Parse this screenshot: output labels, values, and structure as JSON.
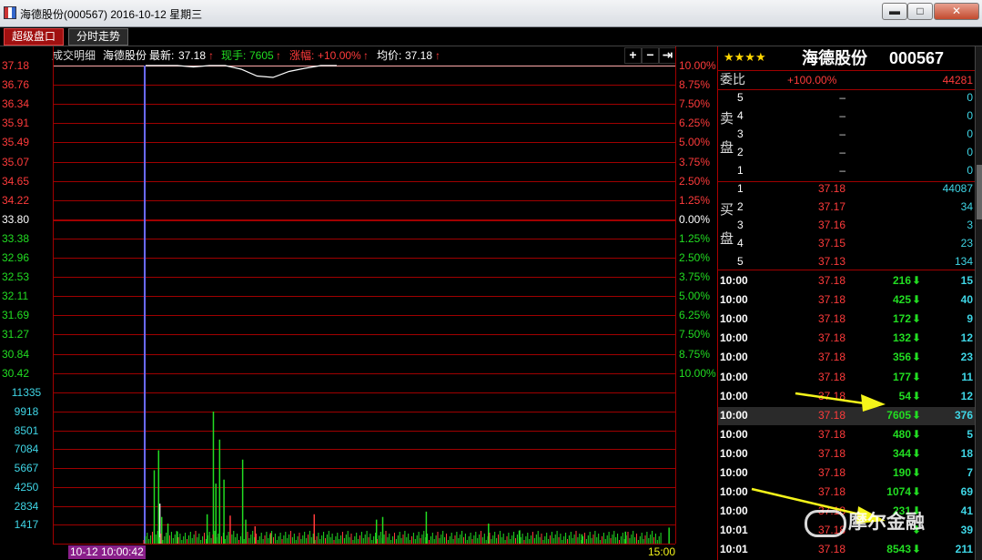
{
  "window": {
    "title": "海德股份(000567) 2016-10-12 星期三",
    "min": "▬",
    "max": "□",
    "close": "✕"
  },
  "tabs": [
    {
      "label": "超级盘口",
      "active": true
    },
    {
      "label": "分时走势",
      "active": false
    }
  ],
  "chart_header": {
    "label_detail": "成交明细",
    "stock": "海德股份",
    "latest_label": "最新:",
    "latest_value": "37.18",
    "volume_label": "现手:",
    "volume_value": "7605",
    "change_label": "涨幅:",
    "change_value": "+10.00%",
    "avg_label": "均价:",
    "avg_value": "37.18",
    "tools": [
      "+",
      "−",
      "⇥"
    ]
  },
  "price_axis": {
    "left": [
      {
        "v": "37.18",
        "c": "#ff3b3b"
      },
      {
        "v": "36.76",
        "c": "#ff3b3b"
      },
      {
        "v": "36.34",
        "c": "#ff3b3b"
      },
      {
        "v": "35.91",
        "c": "#ff3b3b"
      },
      {
        "v": "35.49",
        "c": "#ff3b3b"
      },
      {
        "v": "35.07",
        "c": "#ff3b3b"
      },
      {
        "v": "34.65",
        "c": "#ff3b3b"
      },
      {
        "v": "34.22",
        "c": "#ff3b3b"
      },
      {
        "v": "33.80",
        "c": "#ffffff"
      },
      {
        "v": "33.38",
        "c": "#22dd22"
      },
      {
        "v": "32.96",
        "c": "#22dd22"
      },
      {
        "v": "32.53",
        "c": "#22dd22"
      },
      {
        "v": "32.11",
        "c": "#22dd22"
      },
      {
        "v": "31.69",
        "c": "#22dd22"
      },
      {
        "v": "31.27",
        "c": "#22dd22"
      },
      {
        "v": "30.84",
        "c": "#22dd22"
      },
      {
        "v": "30.42",
        "c": "#22dd22"
      }
    ],
    "right": [
      {
        "v": "10.00%",
        "c": "#ff3b3b"
      },
      {
        "v": "8.75%",
        "c": "#ff3b3b"
      },
      {
        "v": "7.50%",
        "c": "#ff3b3b"
      },
      {
        "v": "6.25%",
        "c": "#ff3b3b"
      },
      {
        "v": "5.00%",
        "c": "#ff3b3b"
      },
      {
        "v": "3.75%",
        "c": "#ff3b3b"
      },
      {
        "v": "2.50%",
        "c": "#ff3b3b"
      },
      {
        "v": "1.25%",
        "c": "#ff3b3b"
      },
      {
        "v": "0.00%",
        "c": "#ffffff"
      },
      {
        "v": "1.25%",
        "c": "#22dd22"
      },
      {
        "v": "2.50%",
        "c": "#22dd22"
      },
      {
        "v": "3.75%",
        "c": "#22dd22"
      },
      {
        "v": "5.00%",
        "c": "#22dd22"
      },
      {
        "v": "6.25%",
        "c": "#22dd22"
      },
      {
        "v": "7.50%",
        "c": "#22dd22"
      },
      {
        "v": "8.75%",
        "c": "#22dd22"
      },
      {
        "v": "10.00%",
        "c": "#22dd22"
      }
    ]
  },
  "volume_axis": [
    "11335",
    "9918",
    "8501",
    "7084",
    "5667",
    "4250",
    "2834",
    "1417"
  ],
  "time_axis": {
    "cursor": "10-12 10:00:42",
    "end": "15:00"
  },
  "chart_data": {
    "type": "line",
    "price_range": [
      30.42,
      37.18
    ],
    "volume_range": [
      0,
      11335
    ],
    "price_series": {
      "values": [
        37.18,
        37.18,
        37.18,
        37.15,
        37.18,
        37.18,
        37.1,
        36.95,
        36.92,
        37.05,
        37.12,
        37.18,
        37.18
      ]
    },
    "volume_bars": [
      {
        "x": 0.163,
        "v": 5500,
        "c": "g"
      },
      {
        "x": 0.17,
        "v": 7000,
        "c": "g"
      },
      {
        "x": 0.172,
        "v": 3000,
        "c": "w"
      },
      {
        "x": 0.175,
        "v": 2000,
        "c": "g"
      },
      {
        "x": 0.185,
        "v": 1500,
        "c": "g"
      },
      {
        "x": 0.2,
        "v": 900,
        "c": "g"
      },
      {
        "x": 0.248,
        "v": 2200,
        "c": "g"
      },
      {
        "x": 0.258,
        "v": 9900,
        "c": "g"
      },
      {
        "x": 0.262,
        "v": 4500,
        "c": "g"
      },
      {
        "x": 0.268,
        "v": 7800,
        "c": "g"
      },
      {
        "x": 0.275,
        "v": 4800,
        "c": "g"
      },
      {
        "x": 0.285,
        "v": 2100,
        "c": "r"
      },
      {
        "x": 0.305,
        "v": 6300,
        "c": "g"
      },
      {
        "x": 0.31,
        "v": 1800,
        "c": "g"
      },
      {
        "x": 0.325,
        "v": 1300,
        "c": "r"
      },
      {
        "x": 0.35,
        "v": 800,
        "c": "r"
      },
      {
        "x": 0.42,
        "v": 2200,
        "c": "r"
      },
      {
        "x": 0.52,
        "v": 1800,
        "c": "g"
      },
      {
        "x": 0.53,
        "v": 2000,
        "c": "g"
      },
      {
        "x": 0.6,
        "v": 2400,
        "c": "g"
      },
      {
        "x": 0.7,
        "v": 1500,
        "c": "g"
      },
      {
        "x": 0.75,
        "v": 1000,
        "c": "g"
      },
      {
        "x": 0.85,
        "v": 700,
        "c": "g"
      },
      {
        "x": 0.92,
        "v": 900,
        "c": "g"
      },
      {
        "x": 0.99,
        "v": 1200,
        "c": "g"
      }
    ]
  },
  "quote": {
    "stars": "★★★★",
    "name": "海德股份",
    "code": "000567",
    "weibi_label": "委比",
    "weibi_value": "+100.00%",
    "weicha_value": "44281",
    "sell_label_1": "卖",
    "sell_label_2": "盘",
    "sell": [
      {
        "n": "5",
        "p": "–",
        "v": "0"
      },
      {
        "n": "4",
        "p": "–",
        "v": "0"
      },
      {
        "n": "3",
        "p": "–",
        "v": "0"
      },
      {
        "n": "2",
        "p": "–",
        "v": "0"
      },
      {
        "n": "1",
        "p": "–",
        "v": "0"
      }
    ],
    "buy_label_1": "买",
    "buy_label_2": "盘",
    "buy": [
      {
        "n": "1",
        "p": "37.18",
        "v": "44087"
      },
      {
        "n": "2",
        "p": "37.17",
        "v": "34"
      },
      {
        "n": "3",
        "p": "37.16",
        "v": "3"
      },
      {
        "n": "4",
        "p": "37.15",
        "v": "23"
      },
      {
        "n": "5",
        "p": "37.13",
        "v": "134"
      }
    ]
  },
  "ticks": [
    {
      "t": "10:00",
      "p": "37.18",
      "v": "216",
      "n": "15"
    },
    {
      "t": "10:00",
      "p": "37.18",
      "v": "425",
      "n": "40"
    },
    {
      "t": "10:00",
      "p": "37.18",
      "v": "172",
      "n": "9"
    },
    {
      "t": "10:00",
      "p": "37.18",
      "v": "132",
      "n": "12"
    },
    {
      "t": "10:00",
      "p": "37.18",
      "v": "356",
      "n": "23"
    },
    {
      "t": "10:00",
      "p": "37.18",
      "v": "177",
      "n": "11"
    },
    {
      "t": "10:00",
      "p": "37.18",
      "v": "54",
      "n": "12"
    },
    {
      "t": "10:00",
      "p": "37.18",
      "v": "7605",
      "n": "376",
      "hl": true
    },
    {
      "t": "10:00",
      "p": "37.18",
      "v": "480",
      "n": "5"
    },
    {
      "t": "10:00",
      "p": "37.18",
      "v": "344",
      "n": "18"
    },
    {
      "t": "10:00",
      "p": "37.18",
      "v": "190",
      "n": "7"
    },
    {
      "t": "10:00",
      "p": "37.18",
      "v": "1074",
      "n": "69"
    },
    {
      "t": "10:00",
      "p": "37.18",
      "v": "231",
      "n": "41"
    },
    {
      "t": "10:01",
      "p": "37.18",
      "v": "",
      "n": "39"
    },
    {
      "t": "10:01",
      "p": "37.18",
      "v": "8543",
      "n": "211"
    }
  ],
  "watermark": "摩尔金融",
  "colors": {
    "up": "#ff3b3b",
    "down": "#22dd22",
    "grid": "#a00000",
    "cyan": "#3fd6e6",
    "arrow": "#f5f51a"
  }
}
